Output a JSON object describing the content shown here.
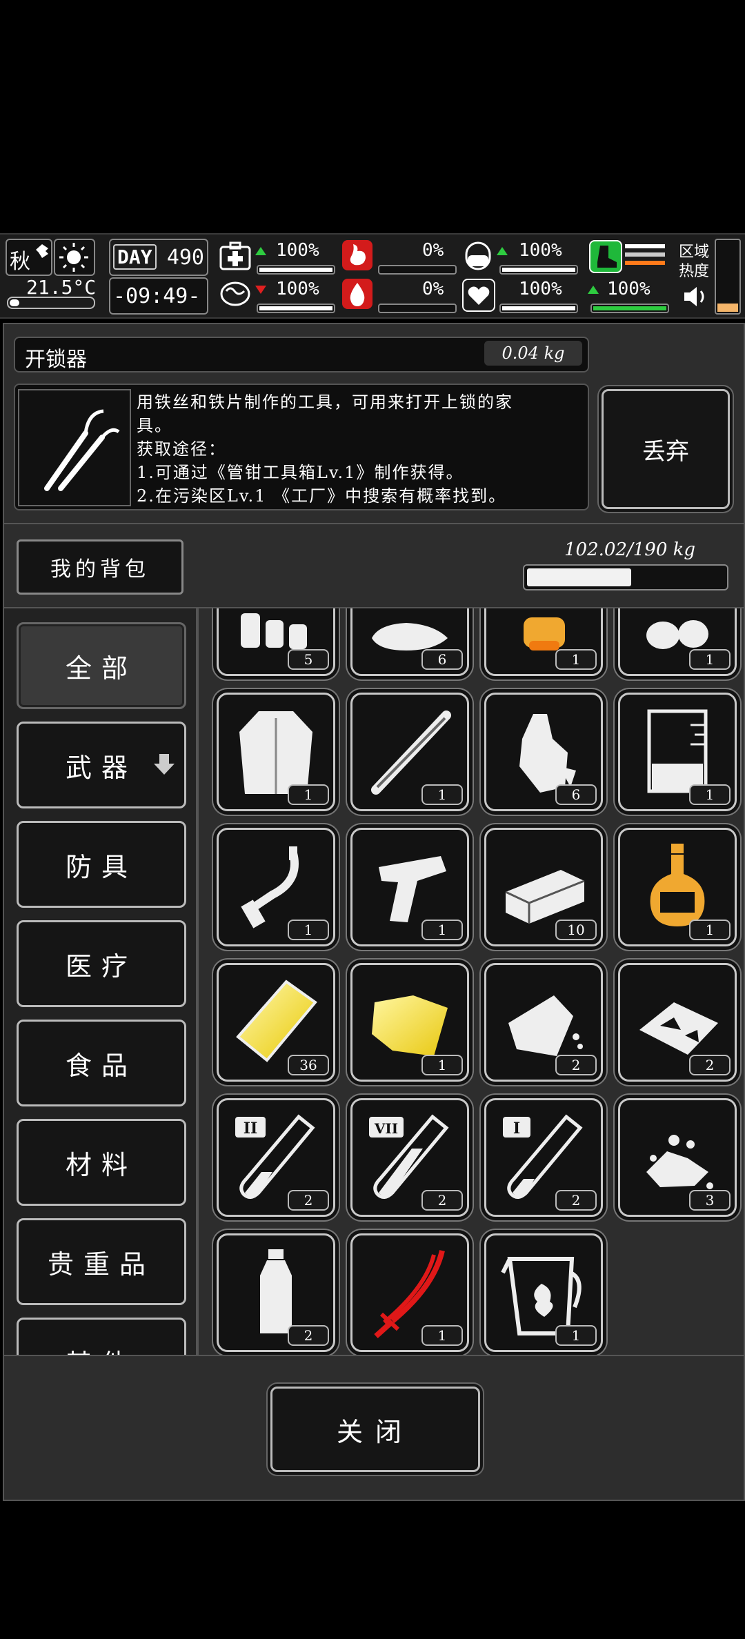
{
  "status": {
    "season": "秋",
    "temperature": "21.5°C",
    "day_label": "DAY",
    "day_number": "490",
    "time": "-09:49-",
    "health_pct": "100%",
    "mood_pct": "100%",
    "hunger_pct": "0%",
    "thirst_pct": "0%",
    "sleep_pct": "100%",
    "heart_pct": "100%",
    "stamina_pct": "100%",
    "zone_heat_label": "区域热度"
  },
  "item": {
    "name": "开锁器",
    "weight": "0.04 kg",
    "desc_lines": [
      "用铁丝和铁片制作的工具，可用来打开上锁的家",
      "具。",
      "获取途径：",
      "1.可通过《管钳工具箱Lv.1》制作获得。",
      "2.在污染区Lv.1 《工厂》中搜索有概率找到。"
    ],
    "discard_label": "丢弃"
  },
  "backpack": {
    "tab_label": "我的背包",
    "weight": "102.02/190 kg",
    "fill_fraction": 0.537
  },
  "categories": [
    "全部",
    "武器",
    "防具",
    "医疗",
    "食品",
    "材料",
    "贵重品",
    "其他"
  ],
  "grid_quantities": [
    [
      "5",
      "6",
      "1",
      "1"
    ],
    [
      "1",
      "1",
      "6",
      "1"
    ],
    [
      "1",
      "1",
      "10",
      "1"
    ],
    [
      "36",
      "1",
      "2",
      "2"
    ],
    [
      "2",
      "2",
      "2",
      "3"
    ],
    [
      "2",
      "1",
      "1"
    ]
  ],
  "close_label": "关闭"
}
